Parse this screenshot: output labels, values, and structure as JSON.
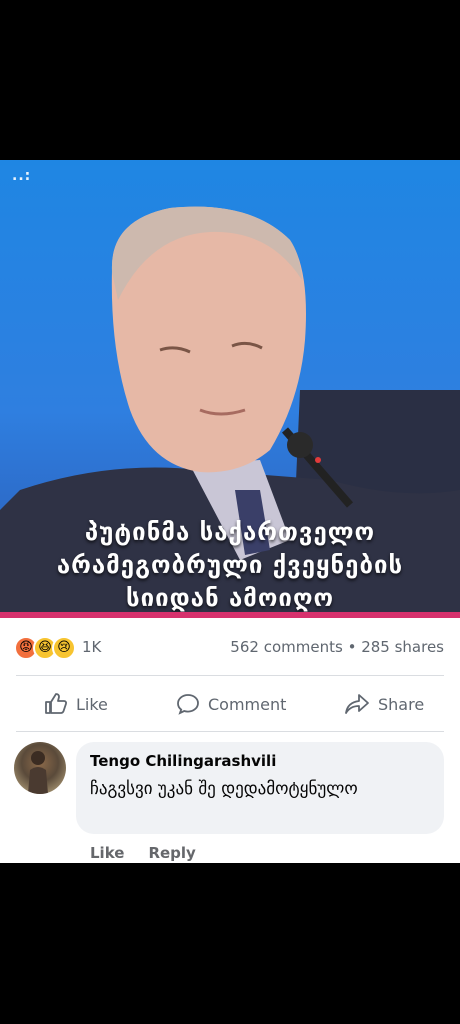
{
  "post": {
    "image": {
      "watermark": "..: ",
      "caption_lines": [
        "პუტინმა საქართველო",
        "არამეგობრული ქვეყნების",
        "სიიდან ამოიღო"
      ]
    },
    "reaction_count": "1K",
    "comments_count": "562 comments",
    "shares_count": "285 shares",
    "separator": "•",
    "actions": {
      "like": "Like",
      "comment": "Comment",
      "share": "Share"
    },
    "colors": {
      "photo_bg": "#2f7fe0",
      "accent_bar": "#d7316d",
      "muted_text": "#606770"
    }
  },
  "comment": {
    "author": "Tengo Chilingarashvili",
    "text": "ჩაგვსვი უკან შე დედამოტყნულო",
    "actions": {
      "like": "Like",
      "reply": "Reply"
    }
  }
}
